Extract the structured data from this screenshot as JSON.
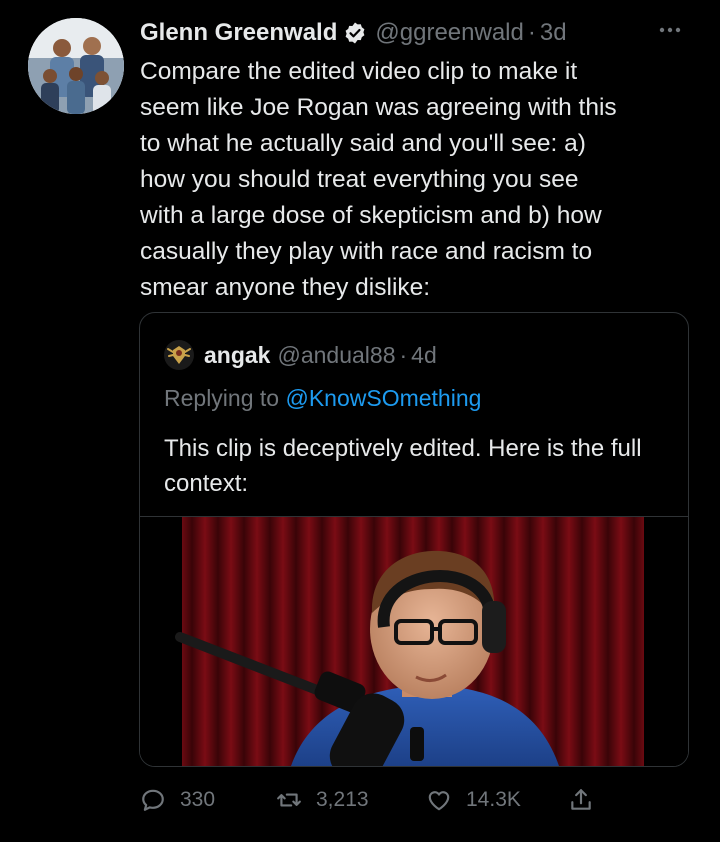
{
  "tweet": {
    "display_name": "Glenn Greenwald",
    "handle": "@ggreenwald",
    "separator": "·",
    "timestamp": "3d",
    "more_icon": "more-dots-icon",
    "verified_icon": "verified-badge-icon",
    "text": "Compare the edited video clip to make it\nseem like Joe Rogan was agreeing with this\nto what he actually said and you'll see: a)\nhow you should treat everything you see\nwith a large dose of skepticism and b) how\ncasually they play with race and racism to\nsmear anyone they dislike:"
  },
  "quote": {
    "display_name": "angak",
    "handle": "@andual88",
    "separator": "·",
    "timestamp": "4d",
    "reply_prefix": "Replying to",
    "reply_mention": "@KnowSOmething",
    "text": "This clip is deceptively edited. Here is the full context:"
  },
  "actions": {
    "reply_count": "330",
    "retweet_count": "3,213",
    "like_count": "14.3K",
    "reply_icon": "reply-icon",
    "retweet_icon": "retweet-icon",
    "like_icon": "heart-icon",
    "share_icon": "share-icon"
  },
  "colors": {
    "background": "#000000",
    "text_primary": "#e7e9ea",
    "text_secondary": "#71767b",
    "link": "#1d9bf0",
    "border": "#2f3336"
  }
}
